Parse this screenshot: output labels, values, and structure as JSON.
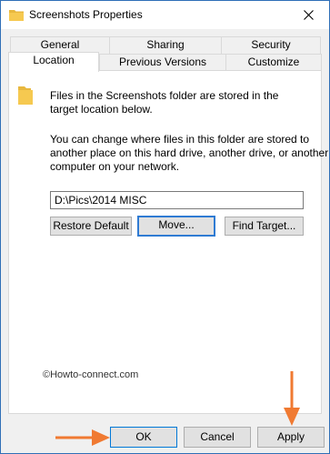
{
  "window": {
    "title": "Screenshots Properties",
    "close_glyph": "close-icon"
  },
  "tabs": {
    "row1": [
      {
        "label": "General"
      },
      {
        "label": "Sharing"
      },
      {
        "label": "Security"
      }
    ],
    "row2": [
      {
        "label": "Location",
        "active": true
      },
      {
        "label": "Previous Versions"
      },
      {
        "label": "Customize"
      }
    ]
  },
  "location": {
    "intro": "Files in the Screenshots folder are stored in the target location below.",
    "intro_line1": "Files in the Screenshots folder are stored in the",
    "intro_line2": "target location below.",
    "desc_line1": "You can change where files in this folder are stored to",
    "desc_line2": "another place on this hard drive, another drive, or another",
    "desc_line3": "computer on your network.",
    "path_value": "D:\\Pics\\2014 MISC",
    "restore_label": "Restore Default",
    "move_label": "Move...",
    "find_label": "Find Target..."
  },
  "watermark": "©Howto-connect.com",
  "footer": {
    "ok_label": "OK",
    "cancel_label": "Cancel",
    "apply_label": "Apply"
  },
  "colors": {
    "accent": "#0078d7",
    "arrow": "#f07a32",
    "folder": "#f6c950"
  }
}
